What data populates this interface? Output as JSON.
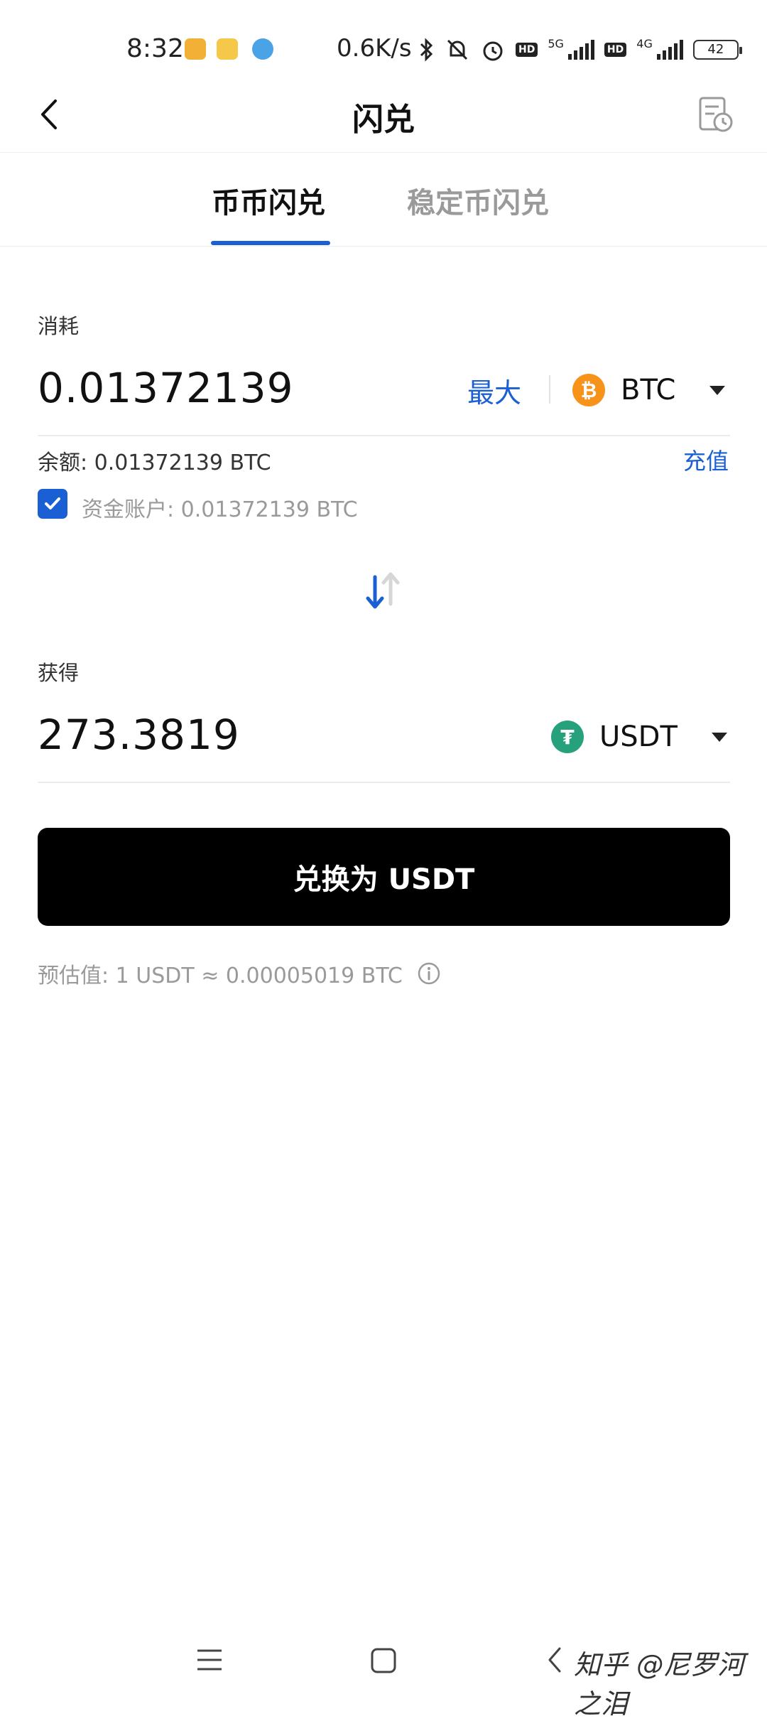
{
  "status_bar": {
    "time": "8:32",
    "net_speed": "0.6K/s",
    "network_1": "5G",
    "network_2": "4G",
    "hd_label": "HD",
    "battery": "42"
  },
  "header": {
    "title": "闪兑"
  },
  "tabs": [
    {
      "label": "币币闪兑",
      "active": true
    },
    {
      "label": "稳定币闪兑",
      "active": false
    }
  ],
  "pay": {
    "label": "消耗",
    "amount": "0.01372139",
    "max_label": "最大",
    "coin": "BTC",
    "coin_icon_glyph": "₿",
    "coin_color": "#f7931a"
  },
  "balance": {
    "text": "余额: 0.01372139 BTC",
    "deposit_label": "充值",
    "fund_account_text": "资金账户: 0.01372139 BTC",
    "fund_account_checked": true
  },
  "receive": {
    "label": "获得",
    "amount": "273.3819",
    "coin": "USDT",
    "coin_icon_glyph": "₮",
    "coin_color": "#26a17b"
  },
  "convert_button": {
    "label": "兑换为 USDT"
  },
  "estimate": {
    "text": "预估值:  1 USDT ≈ 0.00005019 BTC"
  },
  "watermark": {
    "text": "知乎 @尼罗河之泪"
  },
  "colors": {
    "accent": "#1a5fd4",
    "button": "#000000"
  }
}
